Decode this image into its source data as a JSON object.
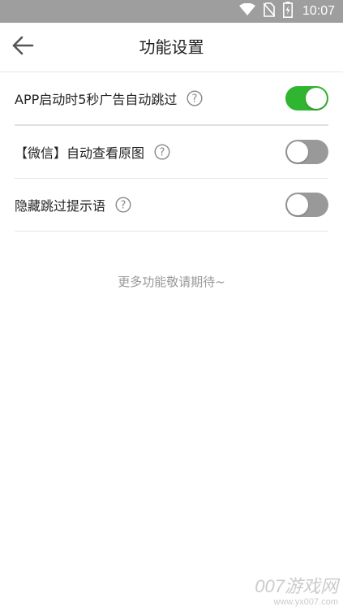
{
  "status_bar": {
    "time": "10:07",
    "icons": [
      "wifi-icon",
      "no-sim-icon",
      "battery-charging-icon"
    ],
    "background_color": "#9e9e9e"
  },
  "header": {
    "back_icon": "arrow-left-icon",
    "title": "功能设置"
  },
  "settings": [
    {
      "label": "APP启动时5秒广告自动跳过",
      "help_icon": "question-circle-icon",
      "enabled": true
    },
    {
      "label": "【微信】自动查看原图",
      "help_icon": "question-circle-icon",
      "enabled": false
    },
    {
      "label": "隐藏跳过提示语",
      "help_icon": "question-circle-icon",
      "enabled": false
    }
  ],
  "footer_note": "更多功能敬请期待~",
  "watermark": {
    "brand": "007游戏网",
    "url": "www.yx007.com"
  },
  "colors": {
    "toggle_on": "#2fb52f",
    "toggle_off": "#999999",
    "divider": "#e6e6e6",
    "muted_text": "#999999"
  }
}
